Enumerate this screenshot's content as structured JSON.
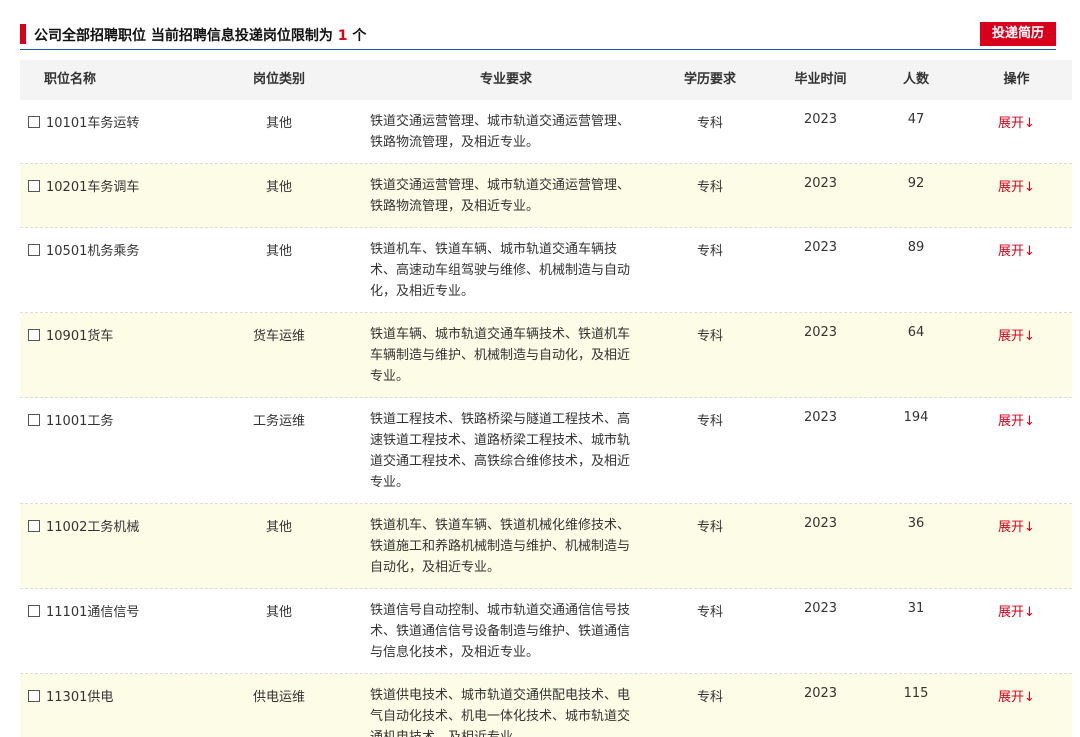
{
  "header": {
    "title_prefix": "公司全部招聘职位  当前招聘信息投递岗位限制为 ",
    "limit": "1",
    "title_suffix": " 个",
    "submit_label": "投递简历"
  },
  "columns": {
    "name": "职位名称",
    "type": "岗位类别",
    "major": "专业要求",
    "education": "学历要求",
    "grad_year": "毕业时间",
    "count": "人数",
    "action": "操作"
  },
  "rows": [
    {
      "name": "10101车务运转",
      "type": "其他",
      "major": "铁道交通运营管理、城市轨道交通运营管理、铁路物流管理，及相近专业。",
      "education": "专科",
      "grad_year": "2023",
      "count": "47",
      "action": "展开↓"
    },
    {
      "name": "10201车务调车",
      "type": "其他",
      "major": "铁道交通运营管理、城市轨道交通运营管理、铁路物流管理，及相近专业。",
      "education": "专科",
      "grad_year": "2023",
      "count": "92",
      "action": "展开↓"
    },
    {
      "name": "10501机务乘务",
      "type": "其他",
      "major": "铁道机车、铁道车辆、城市轨道交通车辆技术、高速动车组驾驶与维修、机械制造与自动化，及相近专业。",
      "education": "专科",
      "grad_year": "2023",
      "count": "89",
      "action": "展开↓"
    },
    {
      "name": "10901货车",
      "type": "货车运维",
      "major": "铁道车辆、城市轨道交通车辆技术、铁道机车车辆制造与维护、机械制造与自动化，及相近专业。",
      "education": "专科",
      "grad_year": "2023",
      "count": "64",
      "action": "展开↓"
    },
    {
      "name": "11001工务",
      "type": "工务运维",
      "major": "铁道工程技术、铁路桥梁与隧道工程技术、高速铁道工程技术、道路桥梁工程技术、城市轨道交通工程技术、高铁综合维修技术，及相近专业。",
      "education": "专科",
      "grad_year": "2023",
      "count": "194",
      "action": "展开↓"
    },
    {
      "name": "11002工务机械",
      "type": "其他",
      "major": "铁道机车、铁道车辆、铁道机械化维修技术、铁道施工和养路机械制造与维护、机械制造与自动化，及相近专业。",
      "education": "专科",
      "grad_year": "2023",
      "count": "36",
      "action": "展开↓"
    },
    {
      "name": "11101通信信号",
      "type": "其他",
      "major": "铁道信号自动控制、城市轨道交通通信信号技术、铁道通信信号设备制造与维护、铁道通信与信息化技术，及相近专业。",
      "education": "专科",
      "grad_year": "2023",
      "count": "31",
      "action": "展开↓"
    },
    {
      "name": "11301供电",
      "type": "供电运维",
      "major": "铁道供电技术、城市轨道交通供配电技术、电气自动化技术、机电一体化技术、城市轨道交通机电技术，及相近专业。",
      "education": "专科",
      "grad_year": "2023",
      "count": "115",
      "action": "展开↓"
    }
  ]
}
